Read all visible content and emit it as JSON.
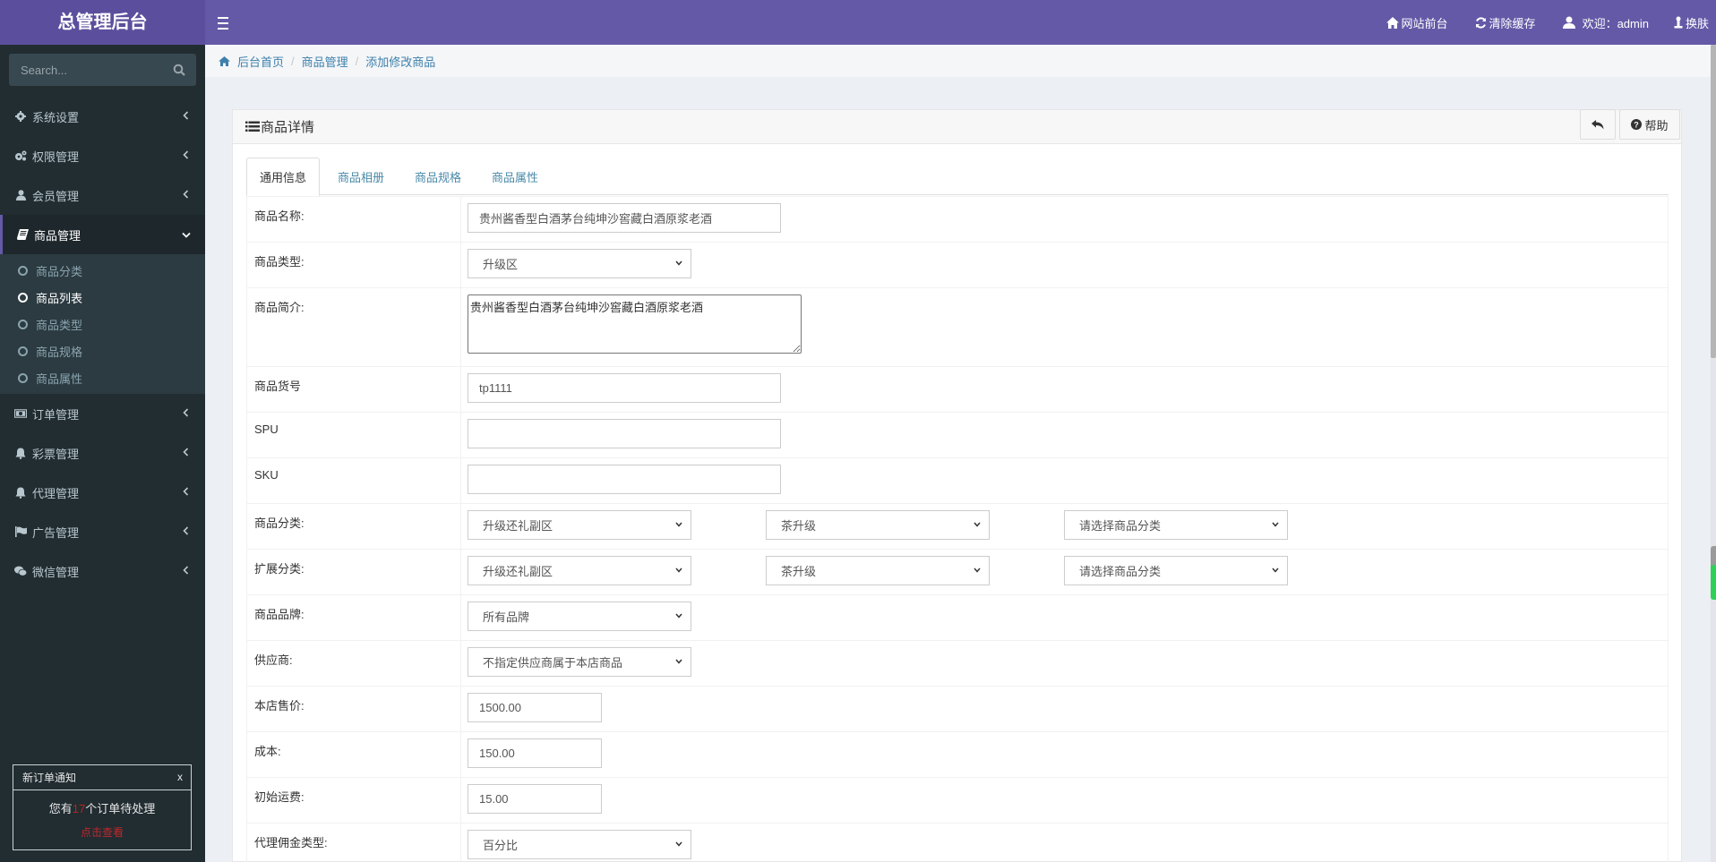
{
  "app": {
    "title": "总管理后台"
  },
  "header": {
    "links": [
      {
        "icon": "home-icon",
        "label": "网站前台"
      },
      {
        "icon": "refresh-icon",
        "label": "清除缓存"
      },
      {
        "icon": "user-icon",
        "label": "欢迎：admin"
      },
      {
        "icon": "skin-icon",
        "label": "换肤"
      }
    ]
  },
  "sidebar": {
    "search_placeholder": "Search...",
    "menu": [
      {
        "icon": "gear-icon",
        "label": "系统设置"
      },
      {
        "icon": "cogs-icon",
        "label": "权限管理"
      },
      {
        "icon": "user-icon",
        "label": "会员管理"
      },
      {
        "icon": "book-icon",
        "label": "商品管理",
        "expanded": true
      },
      {
        "icon": "money-icon",
        "label": "订单管理"
      },
      {
        "icon": "bell-icon",
        "label": "彩票管理"
      },
      {
        "icon": "bell-icon",
        "label": "代理管理"
      },
      {
        "icon": "flag-icon",
        "label": "广告管理"
      },
      {
        "icon": "wechat-icon",
        "label": "微信管理"
      }
    ],
    "submenu": [
      {
        "label": "商品分类"
      },
      {
        "label": "商品列表",
        "current": true
      },
      {
        "label": "商品类型"
      },
      {
        "label": "商品规格"
      },
      {
        "label": "商品属性"
      }
    ],
    "notification": {
      "title": "新订单通知",
      "close": "x",
      "prefix": "您有",
      "count": "17",
      "suffix": "个订单待处理",
      "link": "点击查看"
    }
  },
  "breadcrumb": [
    "后台首页",
    "商品管理",
    "添加修改商品"
  ],
  "panel": {
    "title": "商品详情",
    "help_label": "帮助",
    "tabs": [
      "通用信息",
      "商品相册",
      "商品规格",
      "商品属性"
    ],
    "active_tab": 0
  },
  "form": {
    "name": {
      "label": "商品名称:",
      "value": "贵州酱香型白酒茅台纯坤沙窖藏白酒原浆老酒"
    },
    "type": {
      "label": "商品类型:",
      "value": "升级区"
    },
    "intro": {
      "label": "商品简介:",
      "value": "贵州酱香型白酒茅台纯坤沙窖藏白酒原浆老酒"
    },
    "sn": {
      "label": "商品货号",
      "value": "tp1111"
    },
    "spu": {
      "label": "SPU",
      "value": ""
    },
    "sku": {
      "label": "SKU",
      "value": ""
    },
    "category": {
      "label": "商品分类:",
      "values": [
        "升级还礼副区",
        "茶升级",
        "请选择商品分类"
      ]
    },
    "ext_category": {
      "label": "扩展分类:",
      "values": [
        "升级还礼副区",
        "茶升级",
        "请选择商品分类"
      ]
    },
    "brand": {
      "label": "商品品牌:",
      "value": "所有品牌"
    },
    "supplier": {
      "label": "供应商:",
      "value": "不指定供应商属于本店商品"
    },
    "shop_price": {
      "label": "本店售价:",
      "value": "1500.00"
    },
    "cost": {
      "label": "成本:",
      "value": "150.00"
    },
    "shipping": {
      "label": "初始运费:",
      "value": "15.00"
    },
    "commission_type": {
      "label": "代理佣金类型:",
      "value": "百分比"
    }
  },
  "colors": {
    "header": "#6459a7",
    "brand_bg": "#5b4f9d",
    "sidebar": "#222d32",
    "link": "#3c80ab",
    "alert_red": "#c0262b"
  }
}
